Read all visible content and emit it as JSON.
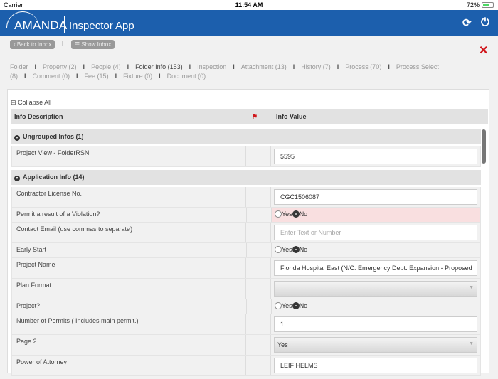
{
  "status": {
    "carrier": "Carrier",
    "time": "11:54 AM",
    "battery": "72%",
    "battery_level": 0.72
  },
  "header": {
    "brand": "AMANDA",
    "app": "Inspector App"
  },
  "nav": {
    "back": "‹ Back to Inbox",
    "sep": "I",
    "show": "☰ Show Inbox"
  },
  "tabs": [
    {
      "label": "Folder"
    },
    {
      "label": "Property (2)"
    },
    {
      "label": "People (4)"
    },
    {
      "label": "Folder Info (153)",
      "active": true
    },
    {
      "label": "Inspection"
    },
    {
      "label": "Attachment (13)"
    },
    {
      "label": "History (7)"
    },
    {
      "label": "Process (70)"
    },
    {
      "label": "Process Select (8)"
    },
    {
      "label": "Comment (0)"
    },
    {
      "label": "Fee (15)"
    },
    {
      "label": "Fixture (0)"
    },
    {
      "label": "Document (0)"
    }
  ],
  "tab_sep": "I",
  "collapse_all": "Collapse All",
  "table": {
    "col_desc": "Info Description",
    "col_value": "Info Value"
  },
  "radio_labels": {
    "yes": "Yes",
    "no": "No"
  },
  "groups": [
    {
      "title": "Ungrouped Infos (1)",
      "rows": [
        {
          "desc": "Project View - FolderRSN",
          "type": "text",
          "value": "5595"
        }
      ]
    },
    {
      "title": "Application Info (14)",
      "rows": [
        {
          "desc": "Contractor License No.",
          "type": "text",
          "value": "CGC1506087"
        },
        {
          "desc": "Permit a result of a Violation?",
          "type": "radio",
          "value": "No",
          "error": true
        },
        {
          "desc": "Contact Email (use commas to separate)",
          "type": "text",
          "value": "",
          "placeholder": "Enter Text or Number"
        },
        {
          "desc": "Early Start",
          "type": "radio",
          "value": "No"
        },
        {
          "desc": "Project Name",
          "type": "text",
          "value": "Florida Hospital East (N/C: Emergency Dept. Expansion - Proposed"
        },
        {
          "desc": "Plan Format",
          "type": "select",
          "value": ""
        },
        {
          "desc": "Project?",
          "type": "radio",
          "value": "No"
        },
        {
          "desc": "Number of Permits ( Includes main permit.)",
          "type": "text",
          "value": "1"
        },
        {
          "desc": "Page 2",
          "type": "select",
          "value": "Yes"
        },
        {
          "desc": "Power of Attorney",
          "type": "text",
          "value": "LEIF HELMS"
        }
      ]
    }
  ]
}
